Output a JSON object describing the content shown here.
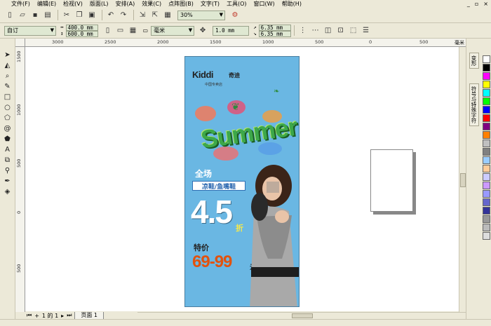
{
  "menubar": {
    "items": [
      "文件(F)",
      "编辑(E)",
      "检视(V)",
      "版面(L)",
      "安排(A)",
      "效果(C)",
      "点阵图(B)",
      "文字(T)",
      "工具(O)",
      "窗口(W)",
      "帮助(H)"
    ],
    "window_controls": [
      "_",
      "▫",
      "×"
    ]
  },
  "toolbar1": {
    "zoom_value": "30%"
  },
  "toolbar2": {
    "paper_preset": "自订",
    "width": "400.0 mm",
    "height": "600.0 mm",
    "unit": "毫米",
    "nudge": "1.0 mm",
    "dup_x": "6.35 mm",
    "dup_y": "6.35 mm"
  },
  "rulers": {
    "top_labels": [
      "3000",
      "2500",
      "2000",
      "1500",
      "1000",
      "500",
      "0",
      "500"
    ],
    "top_unit": "毫米",
    "left_labels": [
      "1500",
      "1000",
      "500",
      "0",
      "500"
    ]
  },
  "dockers": {
    "tabs": [
      "变形",
      "符号与特殊字符"
    ]
  },
  "palette": {
    "colors": [
      "#ffffff",
      "#000000",
      "#ff00ff",
      "#ffff00",
      "#00ffff",
      "#00ff00",
      "#0000ff",
      "#ff0000",
      "#800080",
      "#ff8000",
      "#c0c0c0",
      "#808080",
      "#99ccff",
      "#ffcc99",
      "#ccccff",
      "#cc99ff",
      "#9999ff",
      "#6666cc",
      "#333399",
      "#999999",
      "#bbbbbb",
      "#dddddd"
    ]
  },
  "pagebar": {
    "page_count": "1 的 1",
    "page_tab": "页面 1"
  },
  "poster": {
    "brand": "Kiddi",
    "brand_cn": "奇迪",
    "brand_sub": "中国专卖店",
    "title": "Summer",
    "quanchang": "全场",
    "shoes": "凉鞋/鱼嘴鞋",
    "discount": "4.5",
    "zhe": "折",
    "tejia": "特价",
    "price": "69-99",
    "yuan": "元"
  }
}
